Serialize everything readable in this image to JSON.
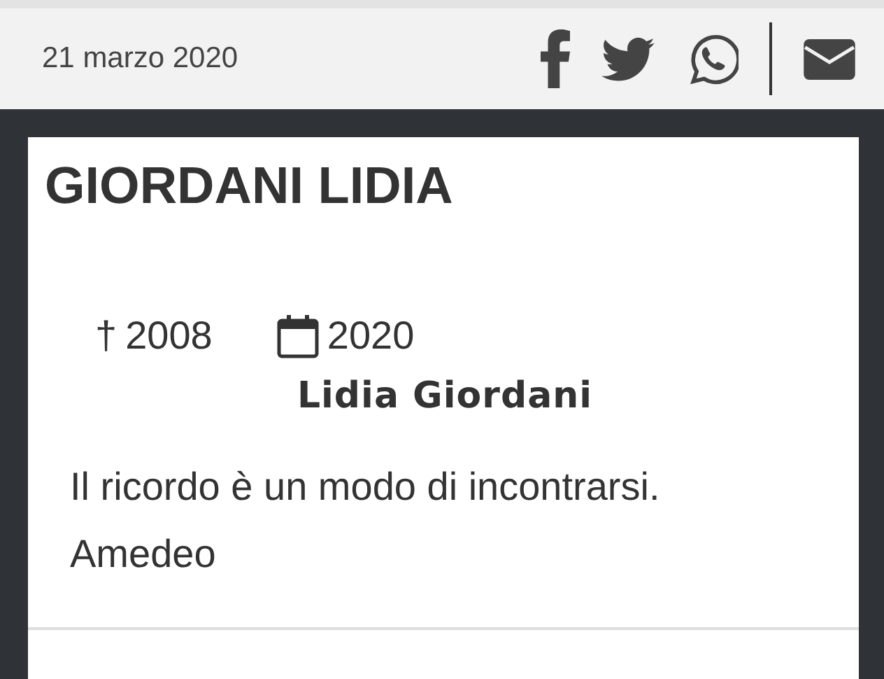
{
  "header": {
    "date": "21 marzo 2020"
  },
  "share_buttons": [
    {
      "kind": "facebook"
    },
    {
      "kind": "twitter"
    },
    {
      "kind": "whatsapp"
    },
    {
      "kind": "email"
    }
  ],
  "card": {
    "title": "GIORDANI LIDIA",
    "death": {
      "symbol": "†",
      "year": "2008"
    },
    "published": {
      "year": "2020"
    },
    "name": "Lidia Giordani",
    "message": [
      "Il ricordo è un modo di incontrarsi.",
      "Amedeo"
    ]
  }
}
